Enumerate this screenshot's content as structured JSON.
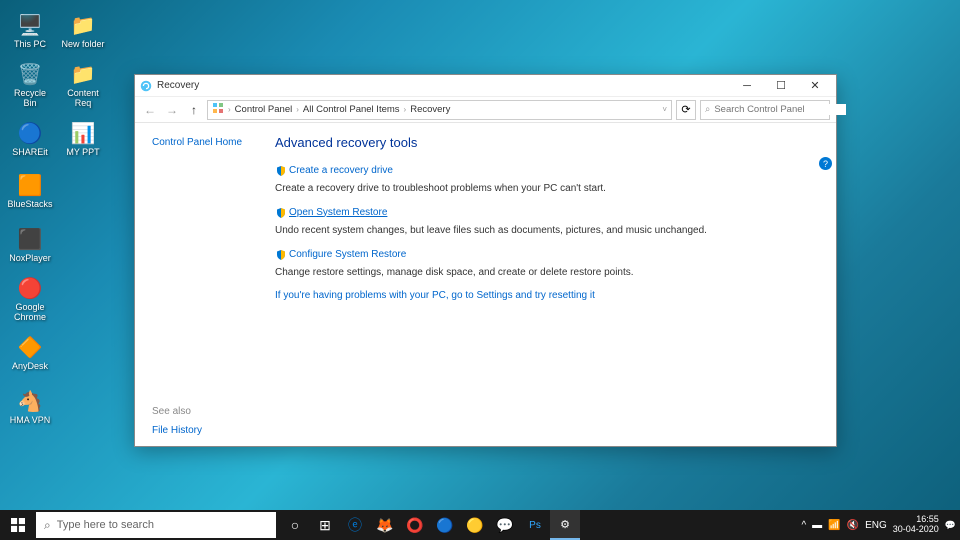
{
  "desktop": {
    "icons_row1": [
      {
        "name": "this-pc",
        "label": "This PC",
        "glyph": "🖥️"
      },
      {
        "name": "new-folder",
        "label": "New folder",
        "glyph": "📁"
      },
      {
        "name": "recycle-bin",
        "label": "Recycle Bin",
        "glyph": "🗑️"
      },
      {
        "name": "content-req",
        "label": "Content Req",
        "glyph": "📁"
      },
      {
        "name": "shareit",
        "label": "SHAREit",
        "glyph": "🔵"
      },
      {
        "name": "my-ppt",
        "label": "MY PPT",
        "glyph": "📊"
      }
    ],
    "icons_col": [
      {
        "name": "bluestacks",
        "label": "BlueStacks",
        "glyph": "🟧"
      },
      {
        "name": "noxplayer",
        "label": "NoxPlayer",
        "glyph": "⬛"
      },
      {
        "name": "google-chrome",
        "label": "Google Chrome",
        "glyph": "🔴"
      },
      {
        "name": "anydesk",
        "label": "AnyDesk",
        "glyph": "🔶"
      },
      {
        "name": "hma-vpn",
        "label": "HMA VPN",
        "glyph": "🐴"
      }
    ]
  },
  "window": {
    "title": "Recovery",
    "breadcrumbs": [
      "Control Panel",
      "All Control Panel Items",
      "Recovery"
    ],
    "search_placeholder": "Search Control Panel",
    "sidebar": {
      "home_link": "Control Panel Home",
      "see_also": "See also",
      "file_history": "File History"
    },
    "main": {
      "heading": "Advanced recovery tools",
      "tools": [
        {
          "title": "Create a recovery drive",
          "desc": "Create a recovery drive to troubleshoot problems when your PC can't start.",
          "highlighted": false
        },
        {
          "title": "Open System Restore",
          "desc": "Undo recent system changes, but leave files such as documents, pictures, and music unchanged.",
          "highlighted": true
        },
        {
          "title": "Configure System Restore",
          "desc": "Change restore settings, manage disk space, and create or delete restore points.",
          "highlighted": false
        }
      ],
      "reset_link": "If you're having problems with your PC, go to Settings and try resetting it"
    }
  },
  "taskbar": {
    "search_placeholder": "Type here to search",
    "lang": "ENG",
    "time": "16:55",
    "date": "30-04-2020"
  }
}
